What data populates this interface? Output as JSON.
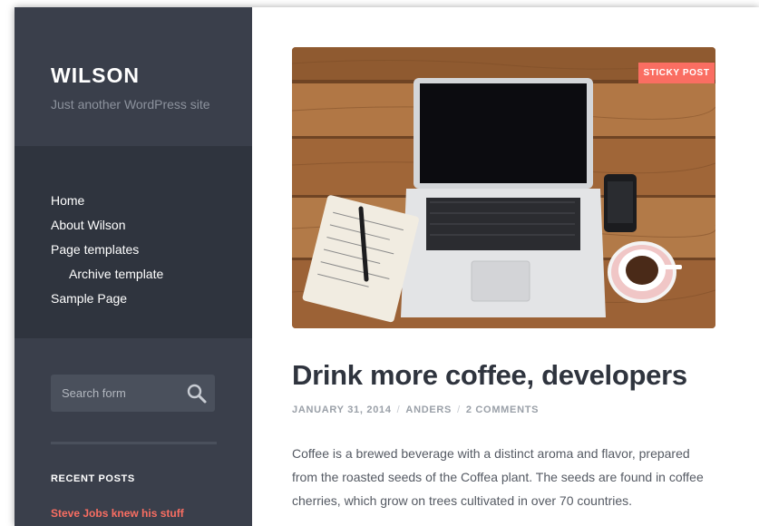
{
  "site": {
    "title": "WILSON",
    "description": "Just another WordPress site"
  },
  "nav": {
    "items": [
      {
        "label": "Home"
      },
      {
        "label": "About Wilson"
      },
      {
        "label": "Page templates"
      },
      {
        "label": "Archive template"
      },
      {
        "label": "Sample Page"
      }
    ]
  },
  "search": {
    "placeholder": "Search form",
    "icon": "search-icon"
  },
  "widgets": {
    "recent_posts_title": "RECENT POSTS",
    "recent_posts": [
      {
        "label": "Steve Jobs knew his stuff"
      }
    ]
  },
  "post": {
    "sticky_label": "STICKY POST",
    "title": "Drink more coffee, developers",
    "date": "JANUARY 31, 2014",
    "author": "ANDERS",
    "comments": "2 COMMENTS",
    "separator": "/",
    "excerpt": "Coffee is a brewed beverage with a distinct aroma and flavor, prepared from the roasted seeds of the Coffea plant. The seeds are found in coffee cherries, which grow on trees cultivated in over 70 countries."
  },
  "colors": {
    "sidebar": "#3a3f4b",
    "nav": "#2f343e",
    "accent": "#fa6e62",
    "title": "#2f343e",
    "meta": "#9aa0a8"
  }
}
